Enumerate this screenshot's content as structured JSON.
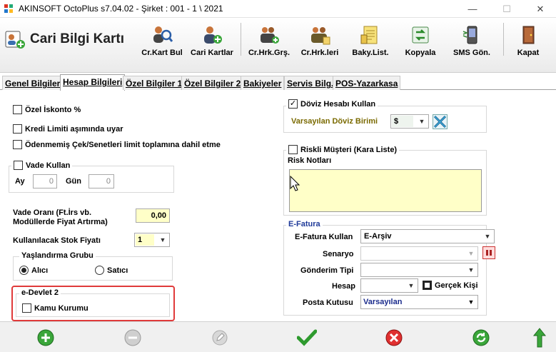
{
  "window": {
    "title": "AKINSOFT OctoPlus s7.04.02  -  Şirket : 001 - 1 \\ 2021",
    "minimize_glyph": "—",
    "maximize_glyph": "☐",
    "close_glyph": "✕"
  },
  "header": {
    "title": "Cari Bilgi Kartı"
  },
  "toolbar": {
    "items": [
      {
        "label": "Cr.Kart Bul",
        "icon": "people-search-icon"
      },
      {
        "label": "Cari Kartlar",
        "icon": "person-add-icon"
      },
      {
        "label": "Cr.Hrk.Grş.",
        "icon": "people-doc-icon"
      },
      {
        "label": "Cr.Hrk.leri",
        "icon": "people-list-icon"
      },
      {
        "label": "Baky.List.",
        "icon": "balance-list-icon"
      },
      {
        "label": "Kopyala",
        "icon": "copy-icon"
      },
      {
        "label": "SMS Gön.",
        "icon": "phone-icon"
      },
      {
        "label": "Kapat",
        "icon": "exit-door-icon"
      }
    ]
  },
  "tabs": [
    {
      "label": "Genel Bilgiler",
      "active": false
    },
    {
      "label": "Hesap Bilgileri",
      "active": true
    },
    {
      "label": "Özel Bilgiler 1",
      "active": false
    },
    {
      "label": "Özel Bilgiler 2",
      "active": false
    },
    {
      "label": "Bakiyeler",
      "active": false
    },
    {
      "label": "Servis Bilg.",
      "active": false
    },
    {
      "label": "POS-Yazarkasa",
      "active": false
    }
  ],
  "left": {
    "ozel_iskonto": "Özel İskonto %",
    "kredi_limiti": "Kredi Limiti aşımında uyar",
    "odenmemis": "Ödenmemiş Çek/Senetleri limit toplamına dahil etme",
    "vade_kullan": "Vade Kullan",
    "ay_label": "Ay",
    "ay_value": "0",
    "gun_label": "Gün",
    "gun_value": "0",
    "vade_orani_label": "Vade Oranı (Ft.İrs vb. Modüllerde Fiyat Artırma)",
    "vade_orani_value": "0,00",
    "stok_fiyati_label": "Kullanılacak Stok Fiyatı",
    "stok_fiyati_value": "1",
    "yaslandirma_title": "Yaşlandırma Grubu",
    "alici": "Alıcı",
    "satici": "Satıcı",
    "edevlet_title": "e-Devlet 2",
    "kamu_kurumu": "Kamu Kurumu"
  },
  "right": {
    "doviz_kullan": "Döviz Hesabı Kullan",
    "doviz_birimi_label": "Varsayılan Döviz Birimi",
    "doviz_birimi_value": "$",
    "riskli_musteri": "Riskli Müşteri (Kara Liste)",
    "risk_notlari": "Risk Notları",
    "efatura_title": "E-Fatura",
    "efatura_kullan_label": "E-Fatura Kullan",
    "efatura_kullan_value": "E-Arşiv",
    "senaryo_label": "Senaryo",
    "gonderim_tipi_label": "Gönderim Tipi",
    "hesap_label": "Hesap",
    "gercek_kisi": "Gerçek Kişi",
    "posta_kutusu_label": "Posta Kutusu",
    "posta_kutusu_value": "Varsayılan"
  },
  "colors": {
    "highlight_red": "#e03a3a",
    "note_yellow": "#ffffc8",
    "dark_yellow_text": "#7a6a00",
    "efatura_blue": "#1f3a99",
    "posta_blue": "#1a2b8c"
  }
}
